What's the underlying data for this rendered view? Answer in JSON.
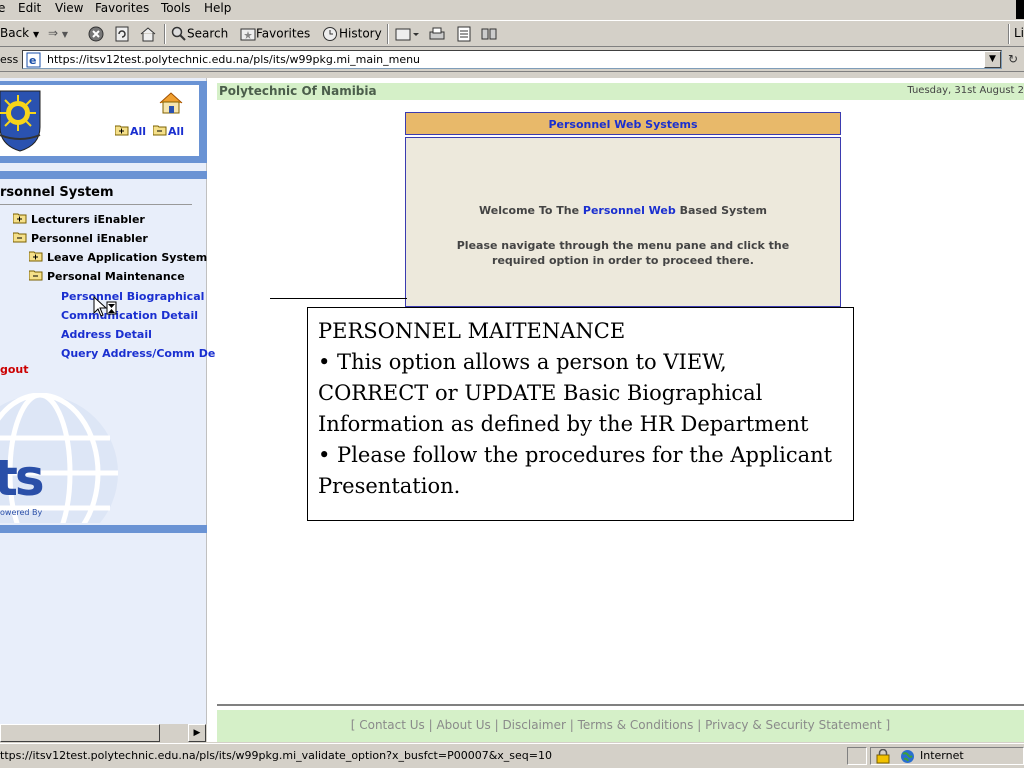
{
  "menu": {
    "items": [
      "e",
      "Edit",
      "View",
      "Favorites",
      "Tools",
      "Help"
    ]
  },
  "toolbar": {
    "back_label": "Back",
    "search_label": "Search",
    "favorites_label": "Favorites",
    "history_label": "History",
    "links_label": "Li"
  },
  "address": {
    "label": "ess",
    "url": "https://itsv12test.polytechnic.edu.na/pls/its/w99pkg.mi_main_menu"
  },
  "sidebar": {
    "expand_all_label": "All",
    "collapse_all_label": "All",
    "section_title": "rsonnel System",
    "items": [
      {
        "label": "Lecturers iEnabler"
      },
      {
        "label": "Personnel iEnabler"
      },
      {
        "label": "Leave Application System"
      },
      {
        "label": "Personal Maintenance"
      },
      {
        "label": "Personnel Biographical"
      },
      {
        "label": "Communication Detail"
      },
      {
        "label": "Address Detail"
      },
      {
        "label": "Query Address/Comm De"
      }
    ],
    "logout_label": "gout",
    "its_logo_text": "ts",
    "powered_by": "owered By"
  },
  "main": {
    "org_name": "Polytechnic Of Namibia",
    "date": "Tuesday, 31st August 2",
    "panel_title": "Personnel Web Systems",
    "welcome_prefix": "Welcome To The ",
    "welcome_highlight": "Personnel Web",
    "welcome_suffix": " Based System",
    "navigate_text": "Please navigate through the menu pane  and click the required option in order to proceed there.",
    "footer": "[ Contact Us | About Us | Disclaimer | Terms & Conditions | Privacy & Security Statement ]"
  },
  "callout": {
    "title": "PERSONNEL MAITENANCE",
    "bullet1": "• This option allows a person to VIEW, CORRECT or UPDATE Basic Biographical Information as defined by the HR Department",
    "bullet2": "• Please follow the procedures for the Applicant Presentation."
  },
  "status": {
    "url": "ttps://itsv12test.polytechnic.edu.na/pls/its/w99pkg.mi_validate_option?x_busfct=P00007&x_seq=10",
    "zone": "Internet"
  }
}
